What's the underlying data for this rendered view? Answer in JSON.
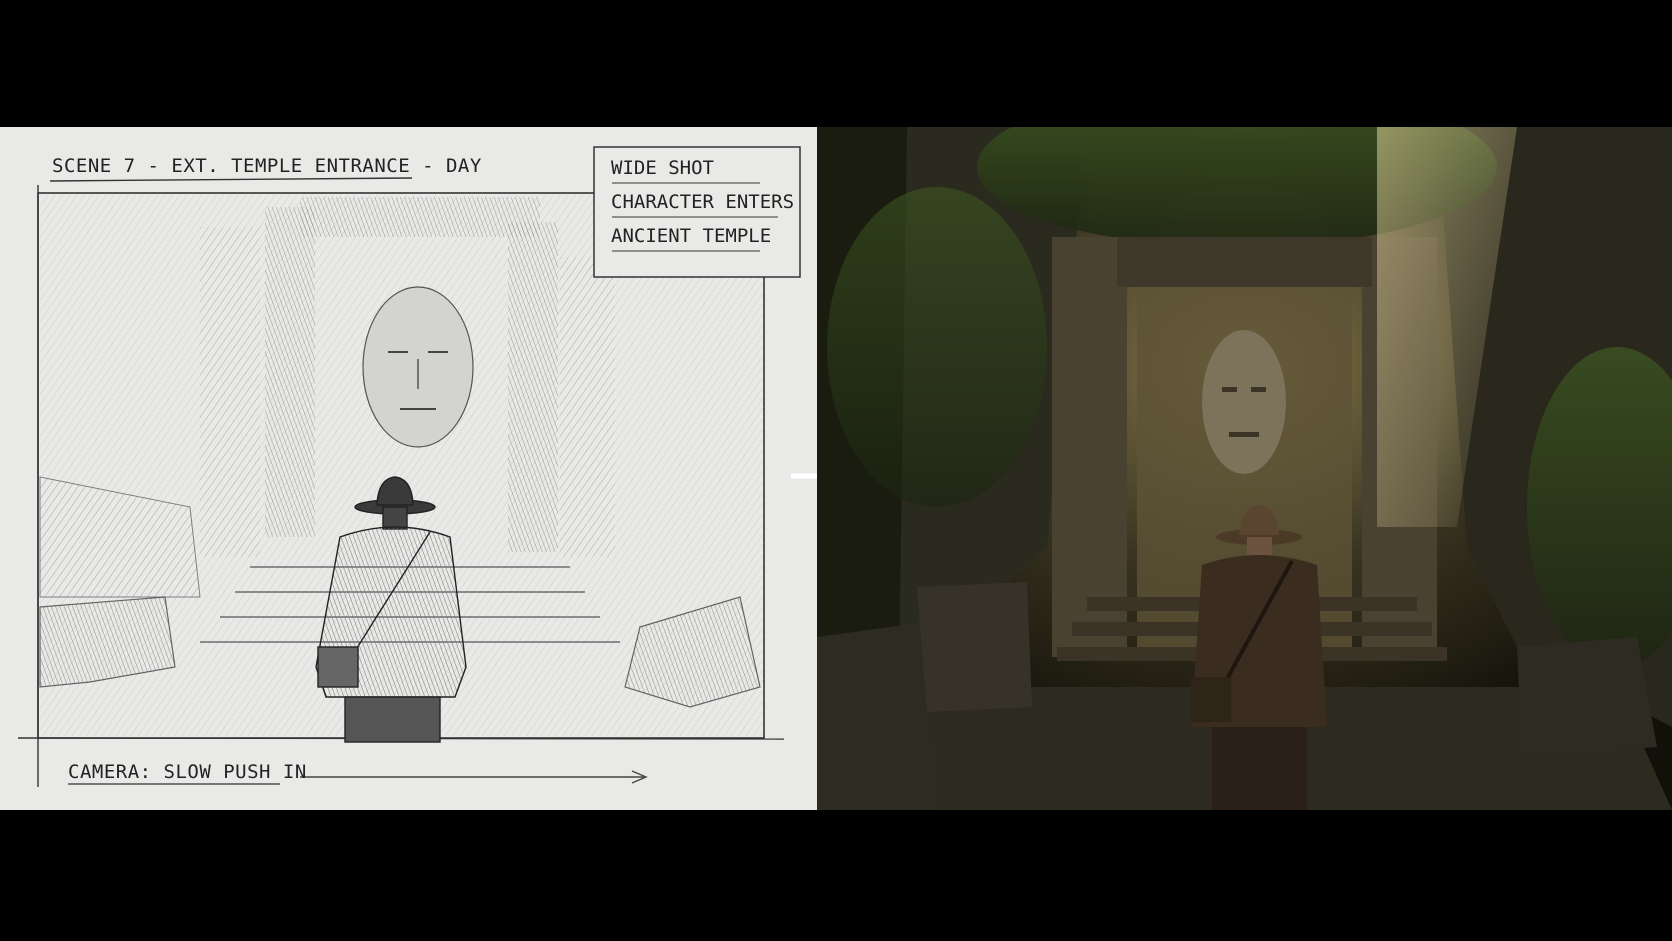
{
  "sketch": {
    "scene_title": "SCENE 7 - EXT. TEMPLE ENTRANCE - DAY",
    "notes": [
      "WIDE SHOT",
      "CHARACTER ENTERS",
      "ANCIENT TEMPLE"
    ],
    "camera_note": "CAMERA: SLOW PUSH IN"
  },
  "arrow": {
    "icon": "right-arrow-icon",
    "color": "#ffffff"
  },
  "render": {
    "description_icon": "rendered-temple-scene"
  },
  "colors": {
    "background": "#000000",
    "paper": "#e9e9e7",
    "ink": "#222222"
  }
}
